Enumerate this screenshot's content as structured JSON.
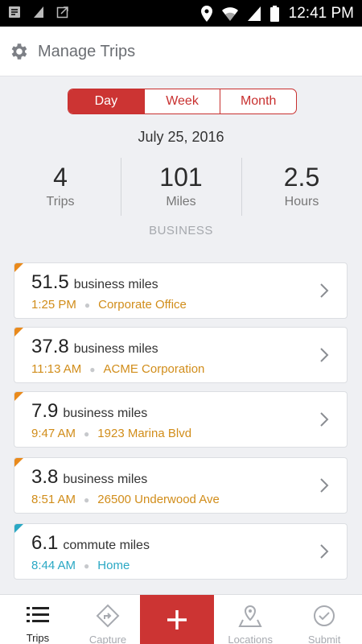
{
  "status_bar": {
    "time": "12:41 PM"
  },
  "header": {
    "title": "Manage Trips",
    "icon": "gear-icon"
  },
  "range_selector": {
    "options": [
      "Day",
      "Week",
      "Month"
    ],
    "selected": "Day"
  },
  "date": "July 25, 2016",
  "stats": [
    {
      "value": "4",
      "label": "Trips"
    },
    {
      "value": "101",
      "label": "Miles"
    },
    {
      "value": "2.5",
      "label": "Hours"
    }
  ],
  "category_label": "BUSINESS",
  "trips": [
    {
      "miles": "51.5",
      "unit": "business miles",
      "time": "1:25 PM",
      "location": "Corporate Office",
      "type": "business"
    },
    {
      "miles": "37.8",
      "unit": "business miles",
      "time": "11:13 AM",
      "location": "ACME Corporation",
      "type": "business"
    },
    {
      "miles": "7.9",
      "unit": "business miles",
      "time": "9:47 AM",
      "location": "1923 Marina Blvd",
      "type": "business"
    },
    {
      "miles": "3.8",
      "unit": "business miles",
      "time": "8:51 AM",
      "location": "26500 Underwood Ave",
      "type": "business"
    },
    {
      "miles": "6.1",
      "unit": "commute miles",
      "time": "8:44 AM",
      "location": "Home",
      "type": "commute"
    }
  ],
  "colors": {
    "accent_red": "#cc3433",
    "business_orange": "#d18d1a",
    "commute_teal": "#2aa8c4"
  },
  "tabbar": {
    "items": [
      {
        "label": "Trips",
        "icon": "list-icon"
      },
      {
        "label": "Capture",
        "icon": "navigation-icon"
      },
      {
        "label": "",
        "icon": "plus-icon"
      },
      {
        "label": "Locations",
        "icon": "map-pin-icon"
      },
      {
        "label": "Submit",
        "icon": "check-circle-icon"
      }
    ]
  }
}
